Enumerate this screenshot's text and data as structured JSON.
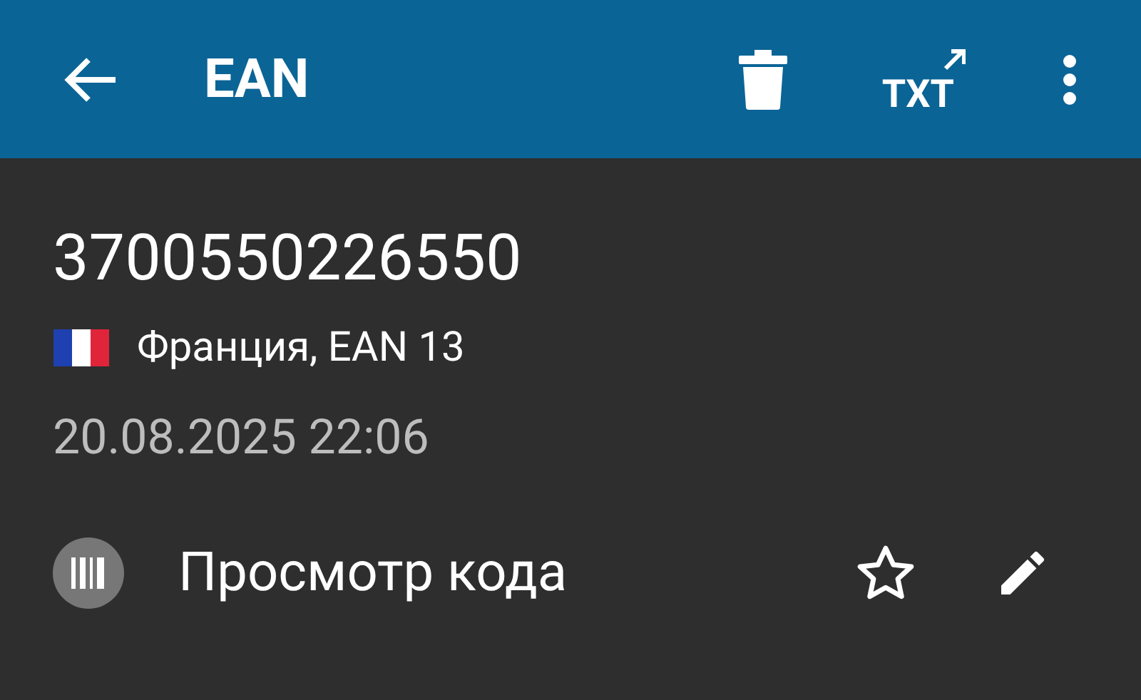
{
  "toolbar": {
    "title": "EAN",
    "export_label": "TXT"
  },
  "code": {
    "value": "3700550226550",
    "country_format": "Франция, EAN 13",
    "date": "20.08.2025 22:06"
  },
  "action": {
    "label": "Просмотр кода",
    "starred": false
  }
}
